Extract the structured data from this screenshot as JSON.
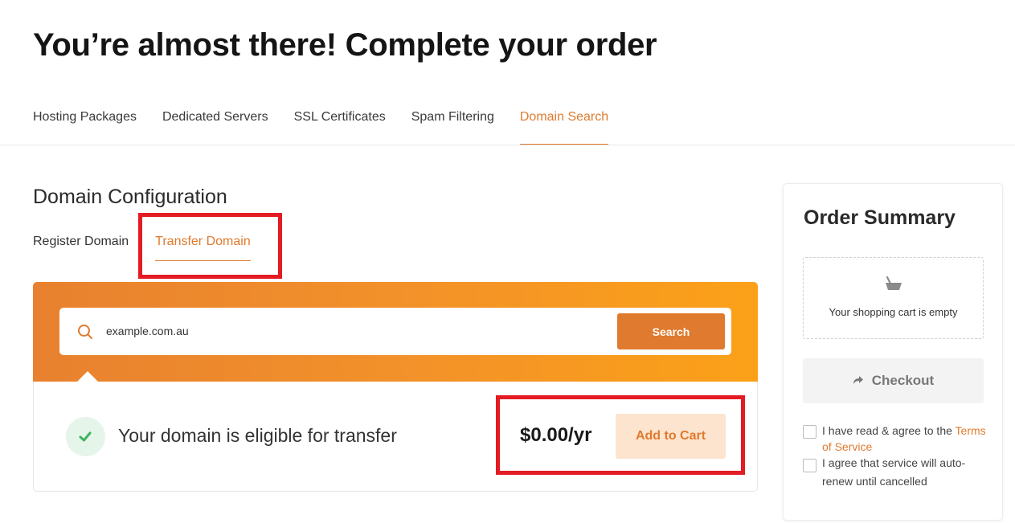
{
  "page": {
    "title": "You’re almost there! Complete your order"
  },
  "main_nav": {
    "items": [
      {
        "label": "Hosting Packages"
      },
      {
        "label": "Dedicated Servers"
      },
      {
        "label": "SSL Certificates"
      },
      {
        "label": "Spam Filtering"
      },
      {
        "label": "Domain Search"
      }
    ],
    "active": "Domain Search"
  },
  "domain_config": {
    "title": "Domain Configuration",
    "tabs": [
      {
        "label": "Register Domain"
      },
      {
        "label": "Transfer Domain"
      }
    ],
    "active_tab": "Transfer Domain",
    "search": {
      "value": "example.com.au",
      "button_label": "Search",
      "icon": "search-icon"
    },
    "result": {
      "message": "Your domain is eligible for transfer",
      "icon": "check-icon",
      "price": "$0.00/yr",
      "add_to_cart_label": "Add to Cart"
    }
  },
  "order_summary": {
    "title": "Order Summary",
    "empty_cart_text": "Your shopping cart is empty",
    "empty_cart_icon": "basket-icon",
    "checkout_label": "Checkout",
    "checkout_icon": "arrow-right-icon",
    "terms_prefix": "I have read & agree to the ",
    "terms_link": "Terms of Service",
    "auto_renew_label": "I agree that service will auto-renew until cancelled"
  },
  "colors": {
    "accent": "#e07a2e",
    "banner_start": "#e8812f",
    "banner_end": "#fba118",
    "highlight": "#e31b23",
    "success_bg": "#e6f5ea",
    "success_check": "#3cb55e"
  }
}
